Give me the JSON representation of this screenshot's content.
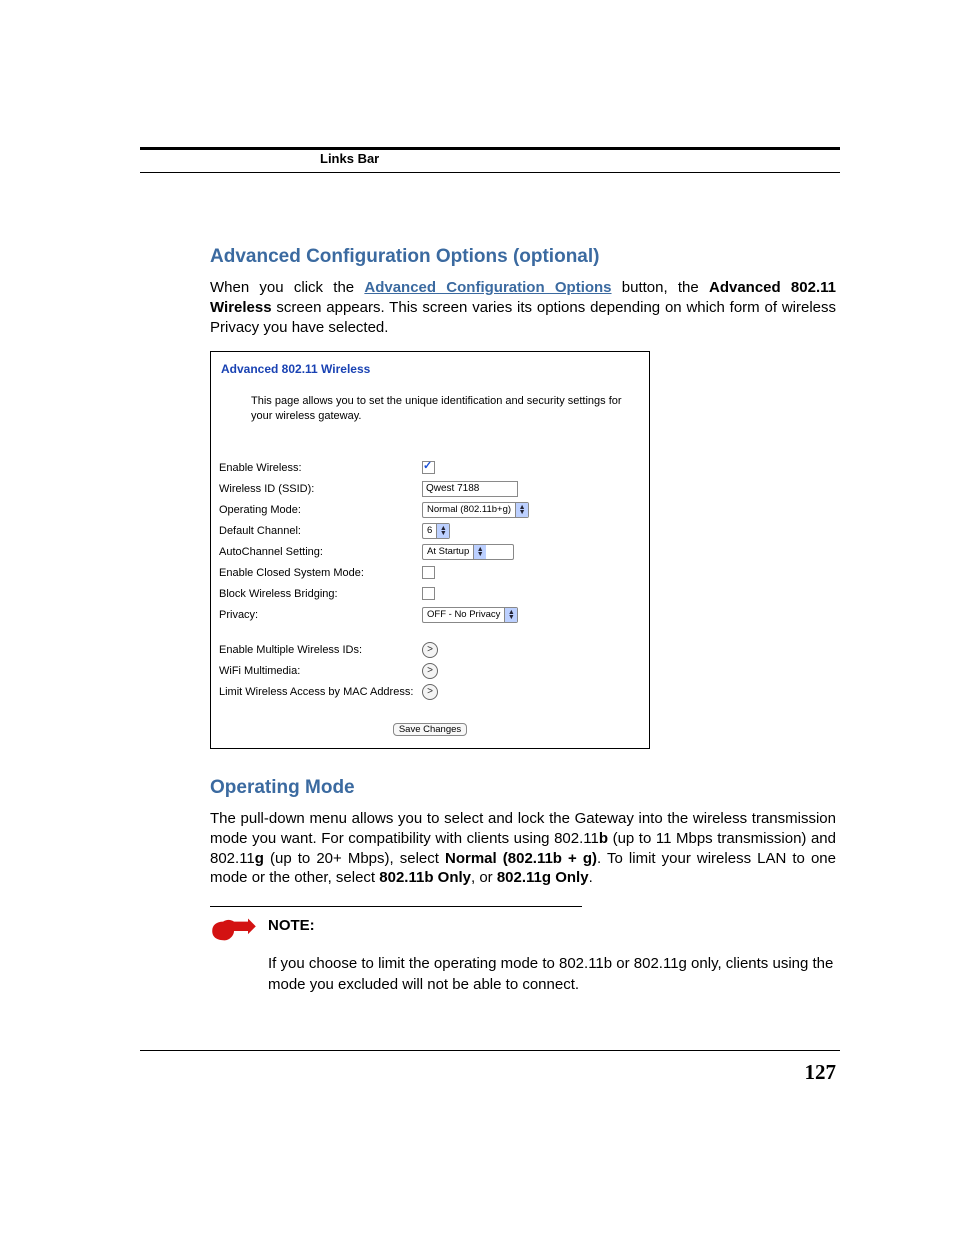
{
  "header": {
    "section": "Links Bar"
  },
  "headings": {
    "advanced": "Advanced Configuration Options (optional)",
    "operating_mode": "Operating Mode"
  },
  "intro": {
    "pre_link": "When you click the ",
    "link": "Advanced Configuration Options",
    "post_link": " button, the ",
    "bold1": "Advanced 802.11 Wireless",
    "rest": " screen appears. This screen varies its options depending on which form of wireless Privacy you have selected."
  },
  "panel": {
    "title": "Advanced 802.11 Wireless",
    "desc": "This page allows you to set the unique identification and security settings for your wireless gateway.",
    "rows": {
      "enable_wireless": "Enable Wireless:",
      "ssid_label": "Wireless ID (SSID):",
      "ssid_value": "Qwest 7188",
      "operating_mode": "Operating Mode:",
      "operating_mode_val": "Normal (802.11b+g)",
      "default_channel": "Default Channel:",
      "default_channel_val": "6",
      "autochannel": "AutoChannel Setting:",
      "autochannel_val": "At Startup",
      "closed_system": "Enable Closed System Mode:",
      "block_bridging": "Block Wireless Bridging:",
      "privacy": "Privacy:",
      "privacy_val": "OFF - No Privacy",
      "multiple_ids": "Enable Multiple Wireless IDs:",
      "wifi_mm": "WiFi Multimedia:",
      "mac_limit": "Limit Wireless Access by MAC Address:"
    },
    "save": "Save Changes"
  },
  "operating_mode_text": {
    "p1a": "The pull-down menu allows you to select and lock the Gateway into the wireless transmission mode you want. For compatibility with clients using 802.11",
    "p1b_bold": "b",
    "p1c": " (up to 11 Mbps transmission) and 802.11",
    "p1d_bold": "g",
    "p1e": " (up to 20+ Mbps), select ",
    "p1f_bold": "Normal (802.11b + g)",
    "p1g": ". To limit your wireless LAN to one mode or the other, select ",
    "p1h_bold": "802.11b Only",
    "p1i": ", or ",
    "p1j_bold": "802.11g Only",
    "p1k": "."
  },
  "note": {
    "label": "NOTE:",
    "text": "If you choose to limit the operating mode to 802.11b or 802.11g only, clients using the mode you excluded will not be able to connect."
  },
  "page_number": "127"
}
